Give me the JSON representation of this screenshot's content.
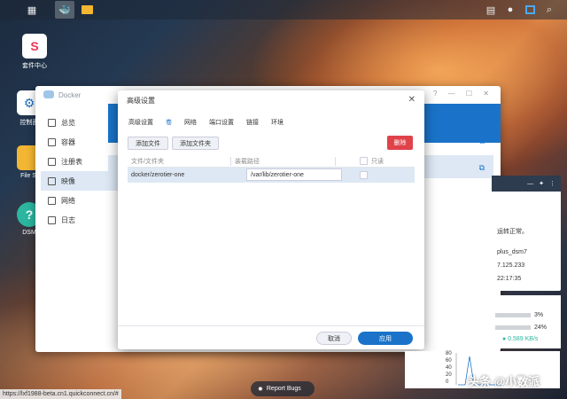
{
  "desktop": {
    "icons": [
      {
        "label": "套件中心"
      },
      {
        "label": "控制面"
      },
      {
        "label": "File St"
      },
      {
        "label": "DSM"
      }
    ]
  },
  "docker": {
    "title": "Docker",
    "sidebar": [
      {
        "label": "总览"
      },
      {
        "label": "容器"
      },
      {
        "label": "注册表"
      },
      {
        "label": "映像"
      },
      {
        "label": "网络"
      },
      {
        "label": "日志"
      }
    ]
  },
  "dialog": {
    "title": "高级设置",
    "tabs": [
      "高级设置",
      "卷",
      "网络",
      "端口设置",
      "链接",
      "环境"
    ],
    "active_tab": "卷",
    "buttons": {
      "add_file": "添加文件",
      "add_folder": "添加文件夹",
      "delete": "删除"
    },
    "table": {
      "headers": [
        "文件/文件夹",
        "装载路径",
        "只读"
      ],
      "rows": [
        {
          "file": "docker/zerotier-one",
          "mount_path": "/var/lib/zerotier-one"
        }
      ]
    },
    "footer": {
      "cancel": "取消",
      "apply": "应用"
    }
  },
  "right_panel": {
    "status_text": "运转正常。",
    "lines": [
      "plus_dsm7",
      "7.125.233",
      "22:17:35"
    ],
    "cpu": "3%",
    "ram": "24%",
    "net": "● 0.589 KB/s",
    "chart_ticks": [
      "80",
      "60",
      "40",
      "20",
      "0"
    ]
  },
  "status_url": "https://lxf1988-beta.cn1.quickconnect.cn/#",
  "report_bugs": "Report Bugs",
  "watermark": "头条 @小数派"
}
